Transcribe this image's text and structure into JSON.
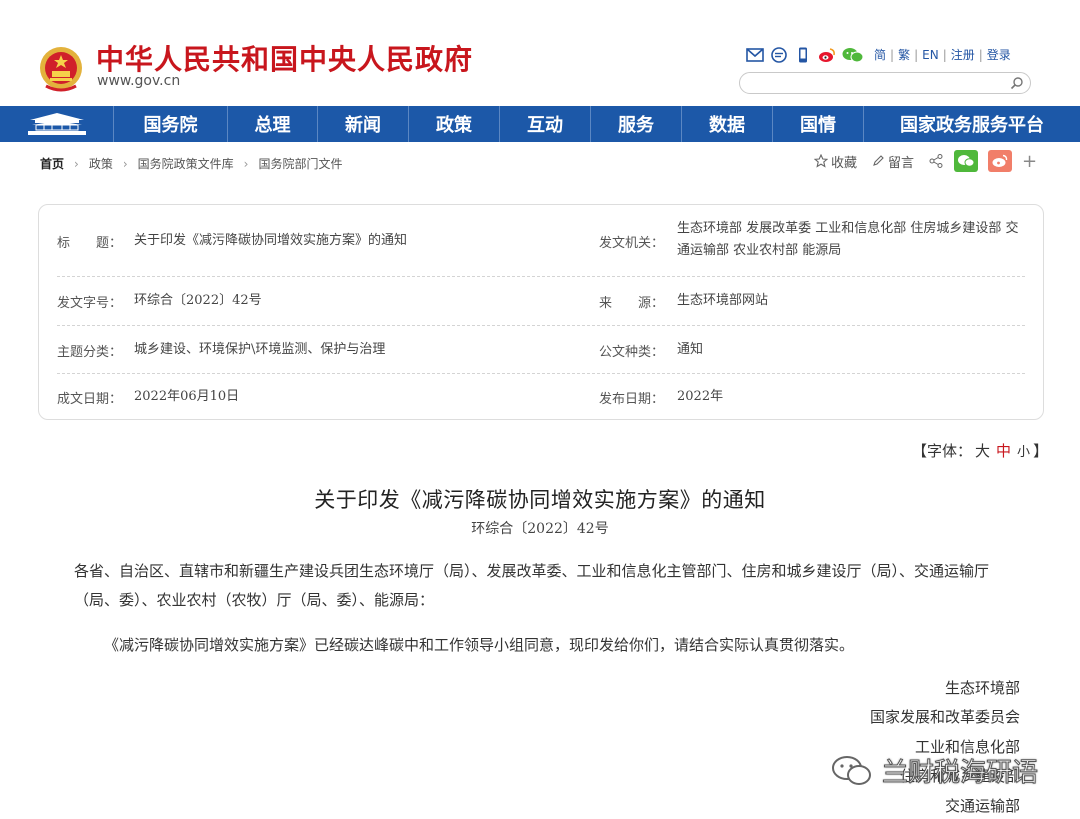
{
  "header": {
    "site_title": "中华人民共和国中央人民政府",
    "site_url": "www.gov.cn",
    "links": [
      "简",
      "繁",
      "EN",
      "注册",
      "登录"
    ],
    "icons": [
      "mail-icon",
      "chat-icon",
      "mobile-icon",
      "weibo-icon",
      "wechat-icon"
    ],
    "search_placeholder": ""
  },
  "nav": {
    "items": [
      "国务院",
      "总理",
      "新闻",
      "政策",
      "互动",
      "服务",
      "数据",
      "国情",
      "国家政务服务平台"
    ]
  },
  "breadcrumb": [
    "首页",
    "政策",
    "国务院政策文件库",
    "国务院部门文件"
  ],
  "tools": {
    "favorite": "收藏",
    "comment": "留言"
  },
  "info": {
    "title_label": "标　　题：",
    "title_value": "关于印发《减污降碳协同增效实施方案》的通知",
    "issuer_label": "发文机关：",
    "issuer_value": "生态环境部 发展改革委 工业和信息化部 住房城乡建设部 交通运输部 农业农村部 能源局",
    "docno_label": "发文字号：",
    "docno_value": "环综合〔2022〕42号",
    "source_label": "来　　源：",
    "source_value": "生态环境部网站",
    "topic_label": "主题分类：",
    "topic_value": "城乡建设、环境保护\\环境监测、保护与治理",
    "type_label": "公文种类：",
    "type_value": "通知",
    "written_label": "成文日期：",
    "written_value": "2022年06月10日",
    "published_label": "发布日期：",
    "published_value": "2022年"
  },
  "fontsize": {
    "prefix": "【字体：",
    "large": "大",
    "medium": "中",
    "small": "小",
    "suffix": "】"
  },
  "document": {
    "title": "关于印发《减污降碳协同增效实施方案》的通知",
    "number": "环综合〔2022〕42号",
    "salutation": "各省、自治区、直辖市和新疆生产建设兵团生态环境厅（局）、发展改革委、工业和信息化主管部门、住房和城乡建设厅（局）、交通运输厅（局、委）、农业农村（农牧）厅（局、委）、能源局：",
    "body": "《减污降碳协同增效实施方案》已经碳达峰碳中和工作领导小组同意，现印发给你们，请结合实际认真贯彻落实。",
    "signatories": [
      "生态环境部",
      "国家发展和改革委员会",
      "工业和信息化部",
      "住房和城乡建设部",
      "交通运输部"
    ]
  },
  "watermark": "兰财税海研语",
  "colors": {
    "brand_red": "#c8161d",
    "nav_blue": "#1c58a8",
    "link_blue": "#2456a4"
  }
}
